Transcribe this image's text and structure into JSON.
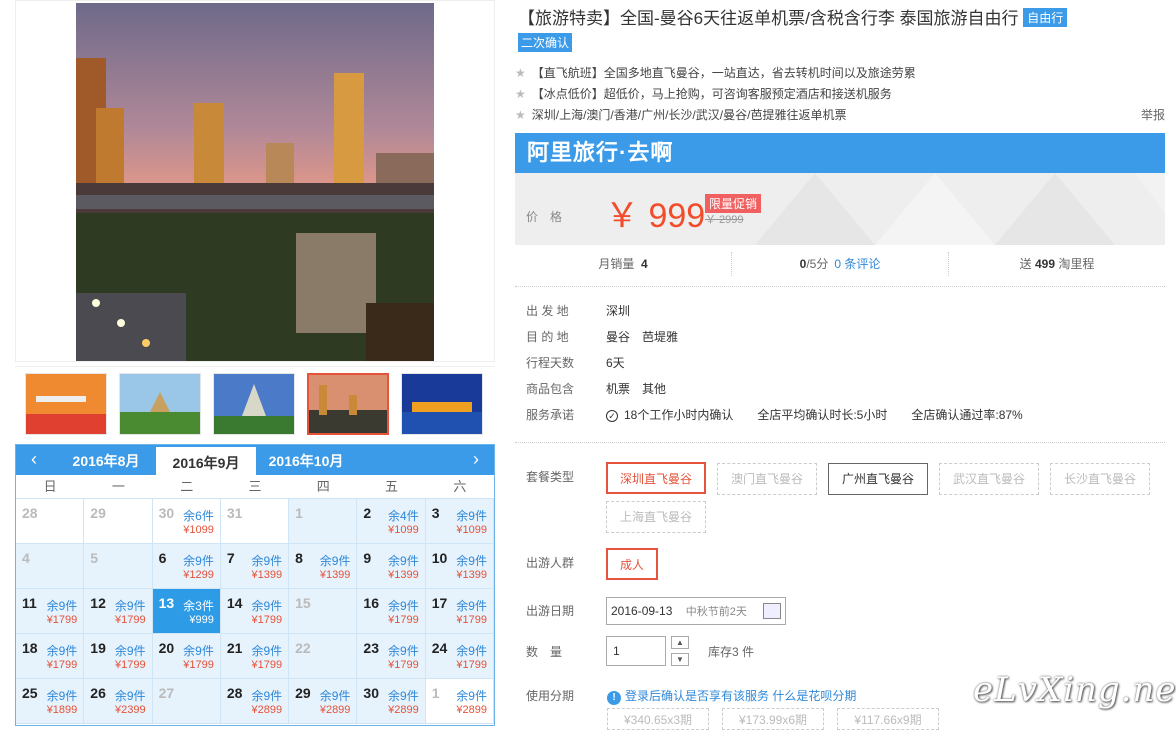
{
  "product": {
    "title": "【旅游特卖】全国-曼谷6天往返单机票/含税含行李 泰国旅游自由行",
    "tag": "自由行",
    "tag2": "二次确认",
    "features": [
      "【直飞航班】全国多地直飞曼谷，一站直达，省去转机时间以及旅途劳累",
      "【冰点低价】超低价，马上抢购，可咨询客服预定酒店和接送机服务",
      "深圳/上海/澳门/香港/广州/长沙/武汉/曼谷/芭提雅往返单机票"
    ],
    "report": "举报"
  },
  "banner": {
    "brand": "阿里旅行·去啊",
    "price_label": "价格",
    "price": "￥ 999",
    "promo": "限量促销",
    "old_price": "￥ 2999"
  },
  "stats": {
    "sales_label": "月销量",
    "sales": "4",
    "rating": "0",
    "rating_suffix": "/5分",
    "reviews": "0 条评论",
    "points_prefix": "送",
    "points": "499",
    "points_suffix": "淘里程"
  },
  "details": [
    {
      "label": "出 发 地",
      "value": "深圳"
    },
    {
      "label": "目 的 地",
      "value": "曼谷　芭堤雅"
    },
    {
      "label": "行程天数",
      "value": "6天"
    },
    {
      "label": "商品包含",
      "value": "机票　其他"
    },
    {
      "label": "服务承诺",
      "value": "18个工作小时内确认　　全店平均确认时长:5小时　　全店确认通过率:87%"
    }
  ],
  "packages": {
    "label": "套餐类型",
    "options": [
      "深圳直飞曼谷",
      "澳门直飞曼谷",
      "广州直飞曼谷",
      "武汉直飞曼谷",
      "长沙直飞曼谷",
      "上海直飞曼谷"
    ]
  },
  "travelers": {
    "label": "出游人群",
    "option": "成人"
  },
  "date": {
    "label": "出游日期",
    "value": "2016-09-13",
    "note": "中秋节前2天"
  },
  "quantity": {
    "label": "数　量",
    "value": "1",
    "stock": "库存3 件"
  },
  "installment": {
    "label": "使用分期",
    "note": "登录后确认是否享有该服务",
    "link": "什么是花呗分期",
    "plans": [
      "¥340.65x3期",
      "¥173.99x6期",
      "¥117.66x9期"
    ]
  },
  "calendar": {
    "months": [
      "2016年8月",
      "2016年9月",
      "2016年10月"
    ],
    "weekdays": [
      "日",
      "一",
      "二",
      "三",
      "四",
      "五",
      "六"
    ],
    "prev": "‹",
    "next": "›",
    "cells": [
      {
        "d": "28",
        "g": 1
      },
      {
        "d": "29",
        "g": 1
      },
      {
        "d": "30",
        "s": "余6件",
        "p": "¥1099",
        "g": 1
      },
      {
        "d": "31",
        "g": 1
      },
      {
        "d": "1",
        "dim": 1
      },
      {
        "d": "2",
        "s": "余4件",
        "p": "¥1099"
      },
      {
        "d": "3",
        "s": "余9件",
        "p": "¥1099"
      },
      {
        "d": "4",
        "dim": 1
      },
      {
        "d": "5",
        "dim": 1
      },
      {
        "d": "6",
        "s": "余9件",
        "p": "¥1299"
      },
      {
        "d": "7",
        "s": "余9件",
        "p": "¥1399"
      },
      {
        "d": "8",
        "s": "余9件",
        "p": "¥1399"
      },
      {
        "d": "9",
        "s": "余9件",
        "p": "¥1399"
      },
      {
        "d": "10",
        "s": "余9件",
        "p": "¥1399"
      },
      {
        "d": "11",
        "s": "余9件",
        "p": "¥1799"
      },
      {
        "d": "12",
        "s": "余9件",
        "p": "¥1799"
      },
      {
        "d": "13",
        "s": "余3件",
        "p": "¥999",
        "sel": 1
      },
      {
        "d": "14",
        "s": "余9件",
        "p": "¥1799"
      },
      {
        "d": "15",
        "dim": 1
      },
      {
        "d": "16",
        "s": "余9件",
        "p": "¥1799"
      },
      {
        "d": "17",
        "s": "余9件",
        "p": "¥1799"
      },
      {
        "d": "18",
        "s": "余9件",
        "p": "¥1799"
      },
      {
        "d": "19",
        "s": "余9件",
        "p": "¥1799"
      },
      {
        "d": "20",
        "s": "余9件",
        "p": "¥1799"
      },
      {
        "d": "21",
        "s": "余9件",
        "p": "¥1799"
      },
      {
        "d": "22",
        "dim": 1
      },
      {
        "d": "23",
        "s": "余9件",
        "p": "¥1799"
      },
      {
        "d": "24",
        "s": "余9件",
        "p": "¥1799"
      },
      {
        "d": "25",
        "s": "余9件",
        "p": "¥1899"
      },
      {
        "d": "26",
        "s": "余9件",
        "p": "¥2399"
      },
      {
        "d": "27",
        "dim": 1
      },
      {
        "d": "28",
        "s": "余9件",
        "p": "¥2899"
      },
      {
        "d": "29",
        "s": "余9件",
        "p": "¥2899"
      },
      {
        "d": "30",
        "s": "余9件",
        "p": "¥2899"
      },
      {
        "d": "1",
        "s": "余9件",
        "p": "¥2899",
        "g": 1
      }
    ]
  },
  "watermark": "eLvXing.net",
  "colors": {
    "accent": "#3b9be8",
    "price": "#f24c2b",
    "select": "#e4533a"
  }
}
